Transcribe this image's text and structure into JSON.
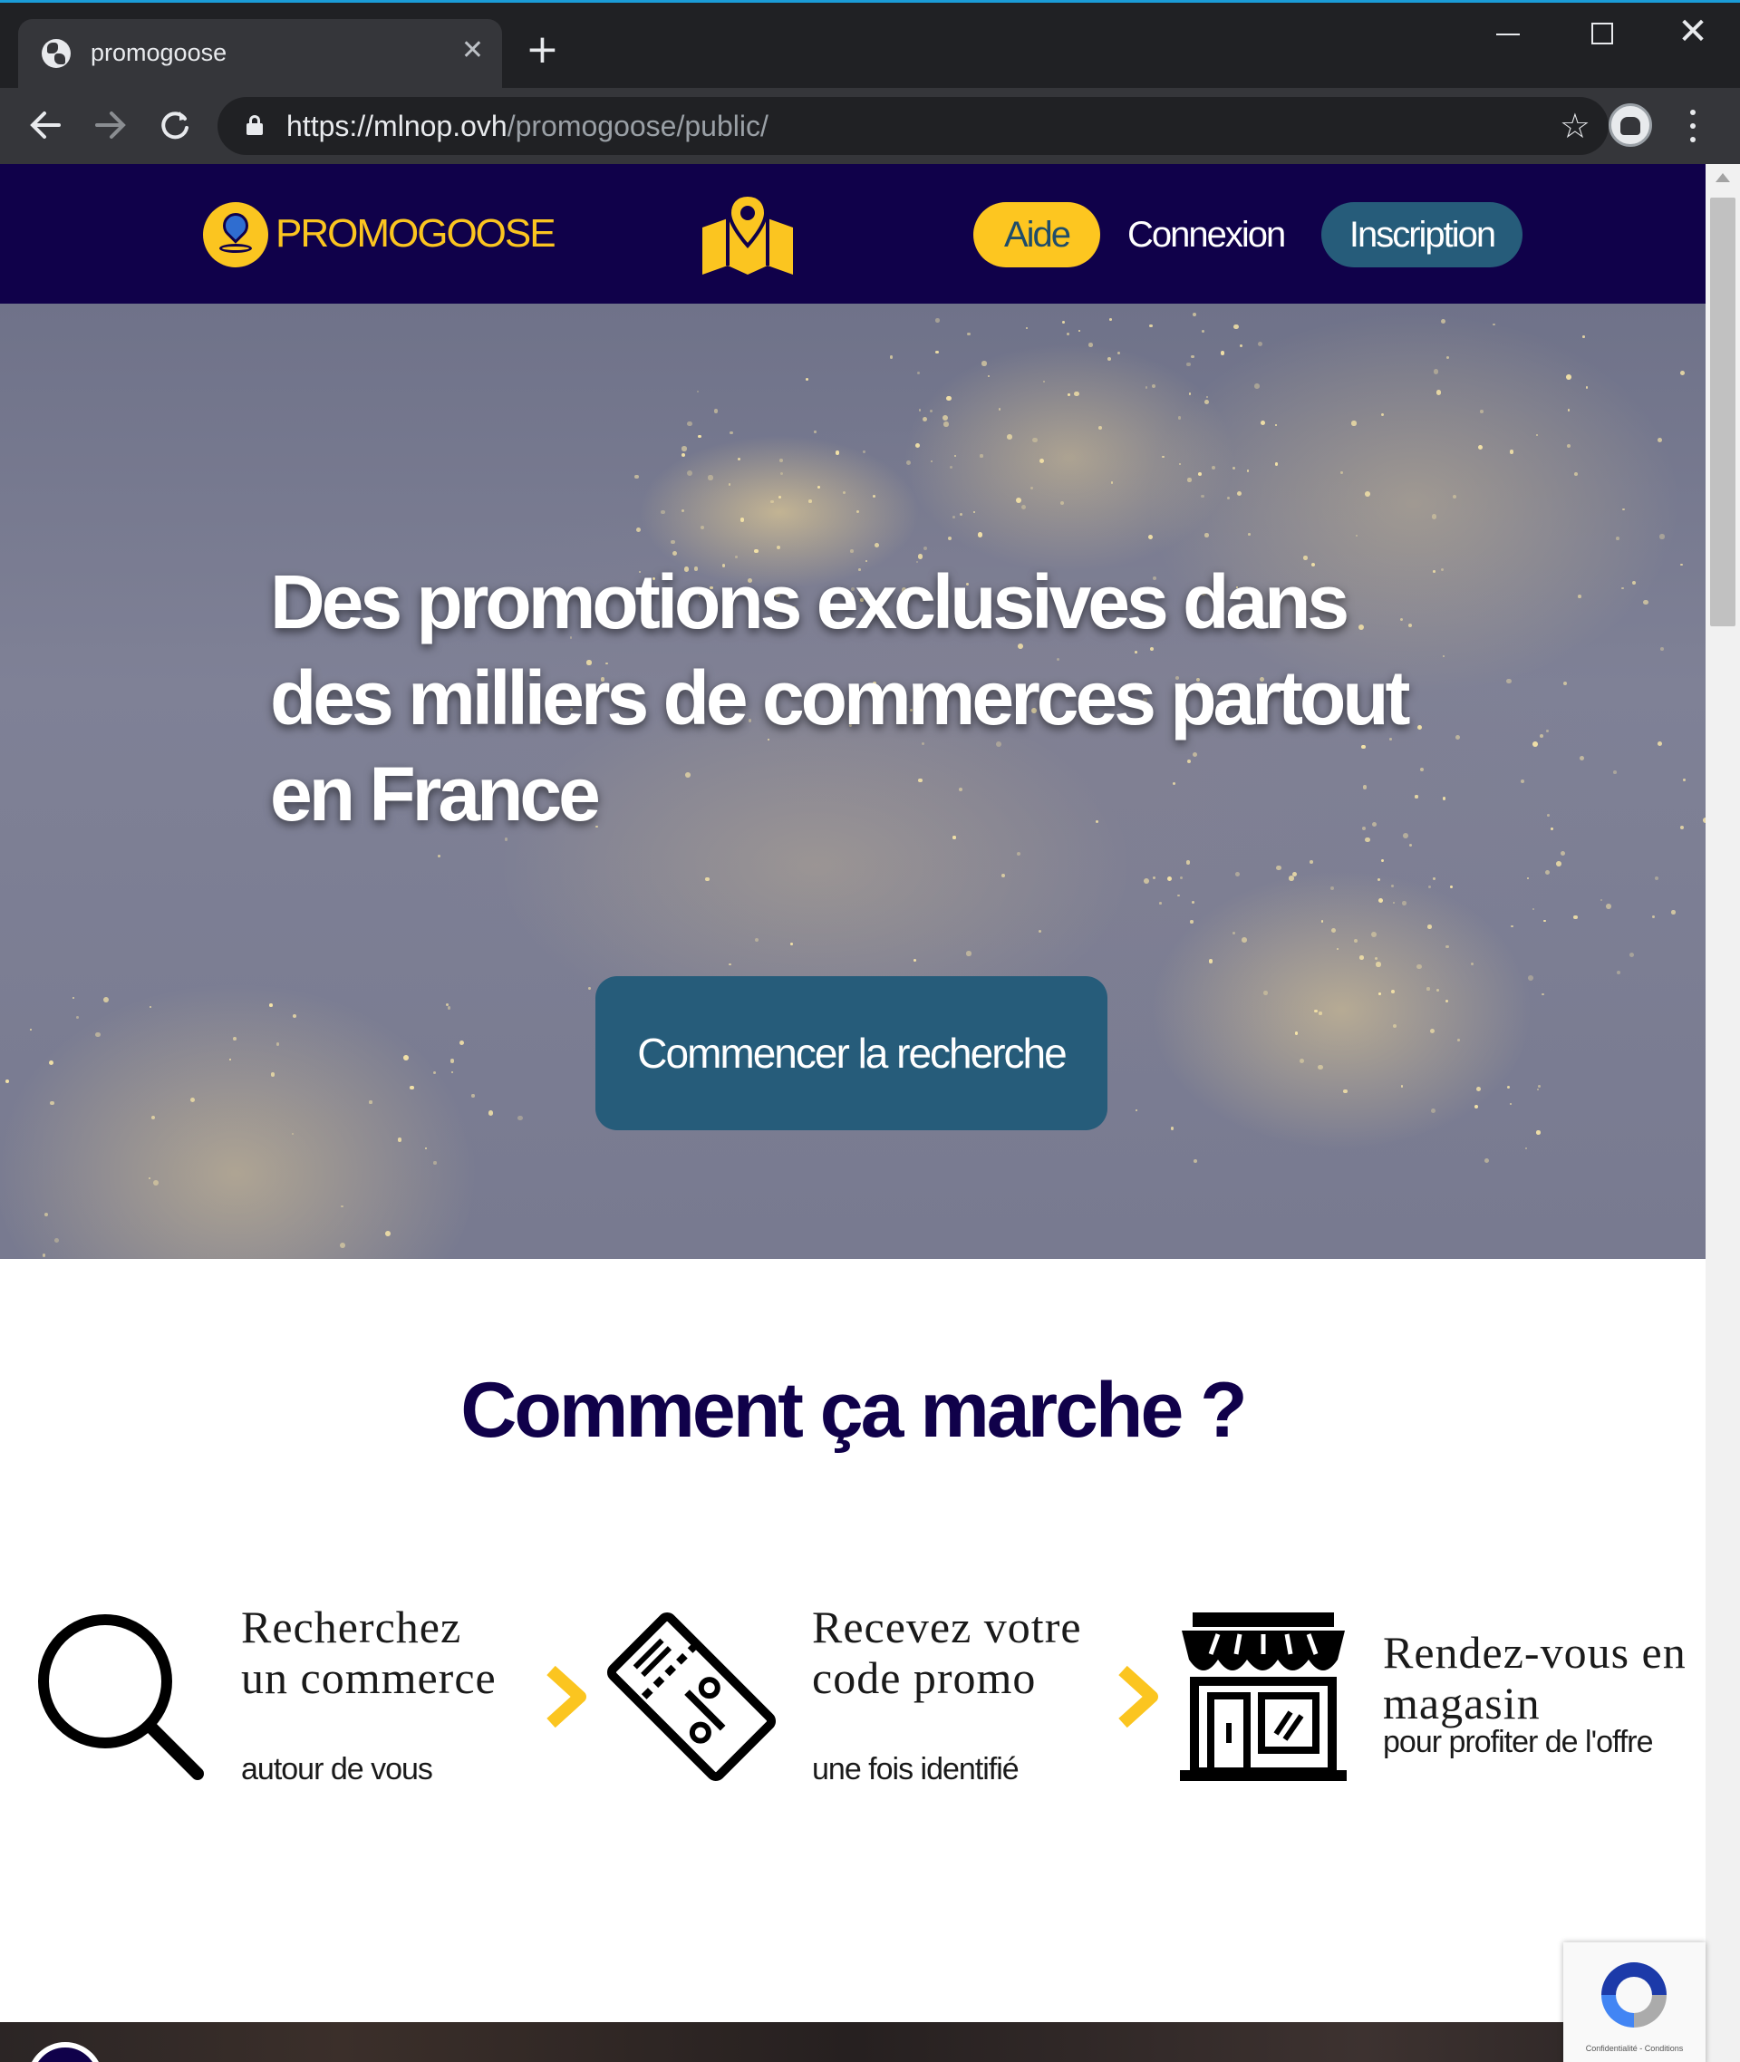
{
  "browser": {
    "tab_title": "promogoose",
    "tab_close": "✕",
    "new_tab": "+",
    "url_host": "https://mlnop.ovh",
    "url_path": "/promogoose/public/",
    "icons": [
      "globe-icon",
      "close-icon",
      "plus-icon",
      "back-arrow-icon",
      "forward-arrow-icon",
      "reload-icon",
      "lock-icon",
      "star-icon",
      "profile-icon",
      "kebab-menu-icon",
      "minimize-icon",
      "maximize-icon",
      "close-window-icon"
    ]
  },
  "header": {
    "logo_text": "PROMOGOOSE",
    "nav": {
      "aide": "Aide",
      "connexion": "Connexion",
      "inscription": "Inscription"
    },
    "colors": {
      "background": "#10014a",
      "accent_yellow": "#fdc620",
      "accent_blue": "#265c7a"
    }
  },
  "hero": {
    "title": "Des promotions exclusives dans des milliers de commerces partout en France",
    "cta": "Commencer la recherche"
  },
  "how_it_works": {
    "title": "Comment ça marche ?",
    "steps": [
      {
        "title": "Recherchez un commerce",
        "subtitle": "autour de vous",
        "icon": "magnifier-icon"
      },
      {
        "title": "Recevez votre code promo",
        "subtitle": "une fois identifié",
        "icon": "coupon-icon"
      },
      {
        "title": "Rendez-vous en magasin",
        "subtitle": "pour profiter de l'offre",
        "icon": "storefront-icon"
      }
    ]
  },
  "recaptcha": {
    "text": "Confidentialité - Conditions"
  }
}
